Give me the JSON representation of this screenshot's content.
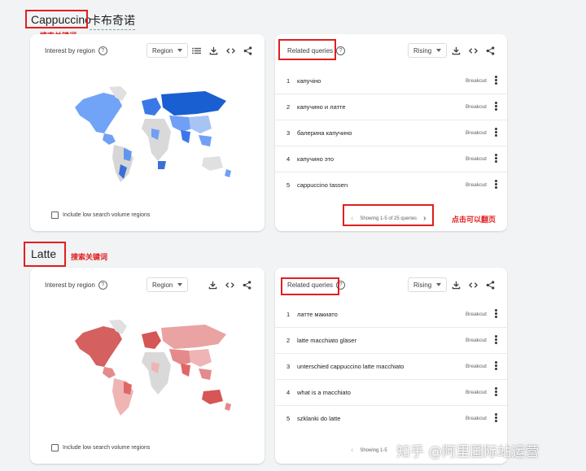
{
  "sections": [
    {
      "keyword": "Cappuccino",
      "keyword_cn": "卡布奇诺",
      "search_label": "搜索关键词",
      "interest": {
        "title": "Interest by region",
        "select": "Region",
        "checkbox_label": "Include low search volume regions"
      },
      "related": {
        "title": "Related queries",
        "select": "Rising",
        "rows": [
          {
            "num": "1",
            "query": "капучіно",
            "value": "Breakout"
          },
          {
            "num": "2",
            "query": "капучино и латте",
            "value": "Breakout"
          },
          {
            "num": "3",
            "query": "балерина капучино",
            "value": "Breakout"
          },
          {
            "num": "4",
            "query": "капучино это",
            "value": "Breakout"
          },
          {
            "num": "5",
            "query": "cappuccino tassen",
            "value": "Breakout"
          }
        ],
        "pager_text": "Showing 1-5 of 25 queries",
        "page_flip_note": "点击可以翻页"
      },
      "map_color": "#4285f4"
    },
    {
      "keyword": "Latte",
      "search_label": "搜索关键词",
      "interest": {
        "title": "Interest by region",
        "select": "Region",
        "checkbox_label": "Include low search volume regions"
      },
      "related": {
        "title": "Related queries",
        "select": "Rising",
        "rows": [
          {
            "num": "1",
            "query": "латте макиато",
            "value": "Breakout"
          },
          {
            "num": "2",
            "query": "latte macchiato gläser",
            "value": "Breakout"
          },
          {
            "num": "3",
            "query": "unterschied cappuccino latte macchiato",
            "value": "Breakout"
          },
          {
            "num": "4",
            "query": "what is a macchiato",
            "value": "Breakout"
          },
          {
            "num": "5",
            "query": "szklanki do latte",
            "value": "Breakout"
          }
        ],
        "pager_text": "Showing 1-5"
      },
      "map_color": "#e06666"
    }
  ],
  "watermark": "知乎 @阿里国际站运营",
  "icons": [
    "help-icon",
    "list-icon",
    "download-icon",
    "embed-icon",
    "share-icon",
    "more-vert-icon",
    "chevron-left-icon",
    "chevron-right-icon"
  ]
}
